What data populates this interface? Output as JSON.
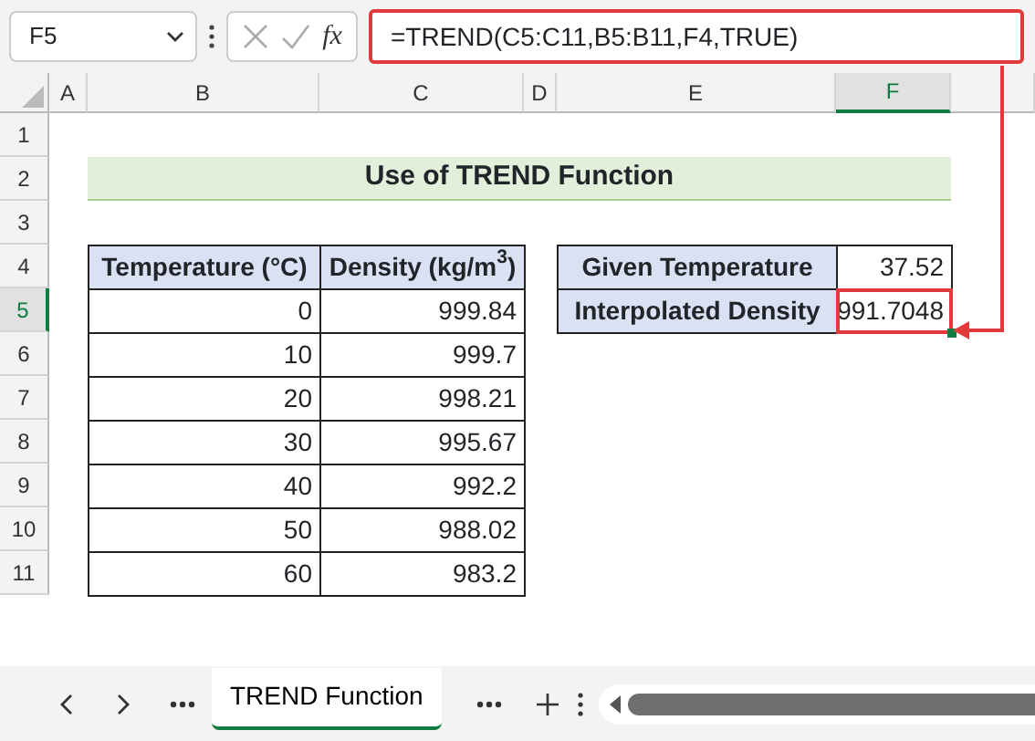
{
  "formula_bar": {
    "name_box": "F5",
    "fx_label": "fx",
    "formula": "=TREND(C5:C11,B5:B11,F4,TRUE)"
  },
  "columns": [
    {
      "label": "A",
      "selected": false
    },
    {
      "label": "B",
      "selected": false
    },
    {
      "label": "C",
      "selected": false
    },
    {
      "label": "D",
      "selected": false
    },
    {
      "label": "E",
      "selected": false
    },
    {
      "label": "F",
      "selected": true
    }
  ],
  "rows": [
    {
      "label": "1",
      "selected": false
    },
    {
      "label": "2",
      "selected": false
    },
    {
      "label": "3",
      "selected": false
    },
    {
      "label": "4",
      "selected": false
    },
    {
      "label": "5",
      "selected": true
    },
    {
      "label": "6",
      "selected": false
    },
    {
      "label": "7",
      "selected": false
    },
    {
      "label": "8",
      "selected": false
    },
    {
      "label": "9",
      "selected": false
    },
    {
      "label": "10",
      "selected": false
    },
    {
      "label": "11",
      "selected": false
    }
  ],
  "title": "Use of TREND Function",
  "table": {
    "columns": [
      "Temperature (°C)",
      "Density (kg/m$^{3}$)"
    ],
    "rows": [
      [
        "0",
        "999.84"
      ],
      [
        "10",
        "999.7"
      ],
      [
        "20",
        "998.21"
      ],
      [
        "30",
        "995.67"
      ],
      [
        "40",
        "992.2"
      ],
      [
        "50",
        "988.02"
      ],
      [
        "60",
        "983.2"
      ]
    ]
  },
  "result": [
    {
      "label": "Given Temperature",
      "value": "37.52",
      "selected": false
    },
    {
      "label": "Interpolated Density",
      "value": "991.7048",
      "selected": true
    }
  ],
  "sheet_tabs": [
    {
      "label": "TREND Function",
      "selected": true
    }
  ]
}
